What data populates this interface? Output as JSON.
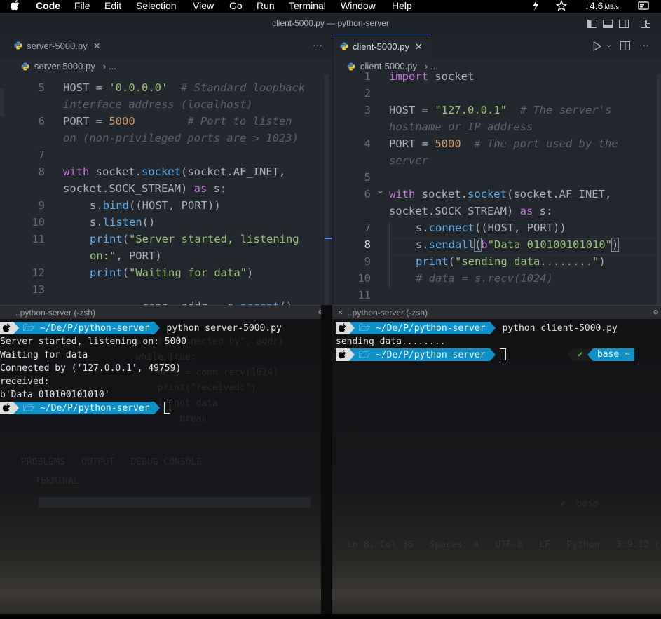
{
  "menubar": {
    "app": "Code",
    "items": [
      "File",
      "Edit",
      "Selection",
      "View",
      "Go",
      "Run",
      "Terminal",
      "Window",
      "Help"
    ],
    "net_speed": "↓4.6",
    "net_unit": "MB/s"
  },
  "window": {
    "title": "client-5000.py — python-server"
  },
  "left_editor": {
    "tab": "server-5000.py",
    "breadcrumb_file": "server-5000.py",
    "breadcrumb_rest": "› ...",
    "line_numbers": [
      "5",
      "6",
      "7",
      "8",
      "9",
      "10",
      "11",
      "12",
      "13"
    ]
  },
  "right_editor": {
    "tab": "client-5000.py",
    "breadcrumb_file": "client-5000.py",
    "breadcrumb_rest": "› ...",
    "line_numbers": [
      "1",
      "2",
      "3",
      "4",
      "5",
      "6",
      "7",
      "8",
      "9",
      "10",
      "11"
    ]
  },
  "left_terminal": {
    "title": "..python-server (-zsh)",
    "prompt_path": "~/De/P/python-server",
    "command": "python server-5000.py",
    "output": [
      "Server started, listening on: 5000",
      "Waiting for data",
      "Connected by ('127.0.0.1', 49759)",
      "received:",
      "b'Data 010100101010'"
    ]
  },
  "right_terminal": {
    "title": "..python-server (-zsh)",
    "prompt_path": "~/De/P/python-server",
    "command": "python client-5000.py",
    "output": [
      "sending data........"
    ],
    "env_check": "✔",
    "env_name": "base"
  },
  "colors": {
    "accent": "#528bff",
    "prompt_blue": "#0d8fc7",
    "keyword": "#c678dd",
    "string": "#98c379",
    "number": "#d19a66"
  }
}
